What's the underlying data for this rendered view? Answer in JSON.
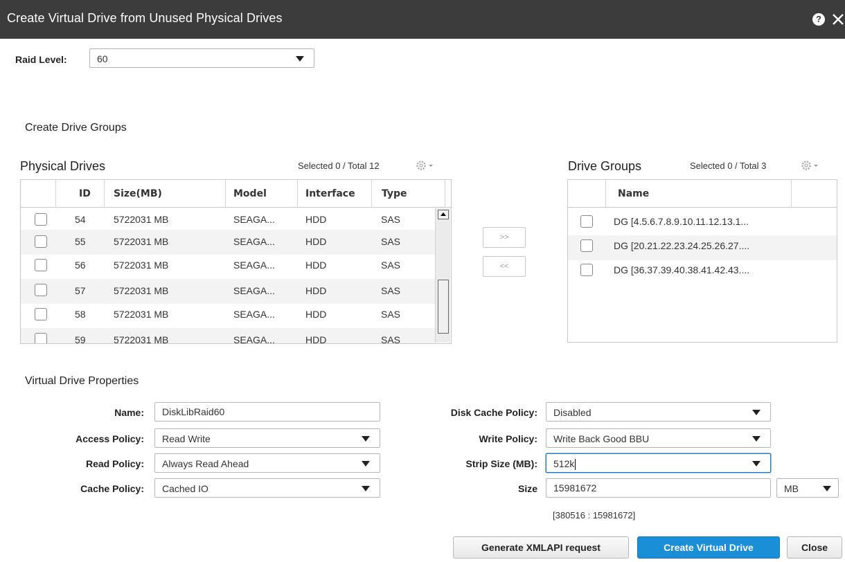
{
  "window": {
    "title": "Create Virtual Drive from Unused Physical Drives"
  },
  "raid": {
    "label": "Raid Level:",
    "value": "60"
  },
  "create_groups": {
    "title": "Create Drive Groups"
  },
  "physical_drives": {
    "title": "Physical Drives",
    "selected": "Selected 0 / Total 12",
    "columns": [
      "ID",
      "Size(MB)",
      "Model",
      "Interface",
      "Type"
    ],
    "rows": [
      {
        "id": "54",
        "size": "5722031 MB",
        "model": "SEAGA...",
        "interface": "HDD",
        "type": "SAS"
      },
      {
        "id": "55",
        "size": "5722031 MB",
        "model": "SEAGA...",
        "interface": "HDD",
        "type": "SAS"
      },
      {
        "id": "56",
        "size": "5722031 MB",
        "model": "SEAGA...",
        "interface": "HDD",
        "type": "SAS"
      },
      {
        "id": "57",
        "size": "5722031 MB",
        "model": "SEAGA...",
        "interface": "HDD",
        "type": "SAS"
      },
      {
        "id": "58",
        "size": "5722031 MB",
        "model": "SEAGA...",
        "interface": "HDD",
        "type": "SAS"
      },
      {
        "id": "59",
        "size": "5722031 MB",
        "model": "SEAGA...",
        "interface": "HDD",
        "type": "SAS"
      }
    ]
  },
  "move": {
    "add": ">>",
    "remove": "<<"
  },
  "drive_groups": {
    "title": "Drive Groups",
    "selected": "Selected 0 / Total 3",
    "columns": [
      "Name"
    ],
    "rows": [
      {
        "name": "DG [4.5.6.7.8.9.10.11.12.13.1..."
      },
      {
        "name": "DG [20.21.22.23.24.25.26.27...."
      },
      {
        "name": "DG [36.37.39.40.38.41.42.43...."
      }
    ]
  },
  "vd_props": {
    "title": "Virtual Drive Properties",
    "name": {
      "label": "Name:",
      "value": "DiskLibRaid60"
    },
    "access_policy": {
      "label": "Access Policy:",
      "value": "Read Write"
    },
    "read_policy": {
      "label": "Read Policy:",
      "value": "Always Read Ahead"
    },
    "cache_policy": {
      "label": "Cache Policy:",
      "value": "Cached IO"
    },
    "disk_cache_policy": {
      "label": "Disk Cache Policy:",
      "value": "Disabled"
    },
    "write_policy": {
      "label": "Write Policy:",
      "value": "Write Back Good BBU"
    },
    "strip_size": {
      "label": "Strip Size (MB):",
      "value": "512k"
    },
    "size": {
      "label": "Size",
      "value": "15981672",
      "unit": "MB",
      "range": "[380516 : 15981672]"
    }
  },
  "buttons": {
    "generate": "Generate XMLAPI request",
    "create": "Create Virtual Drive",
    "close": "Close"
  }
}
